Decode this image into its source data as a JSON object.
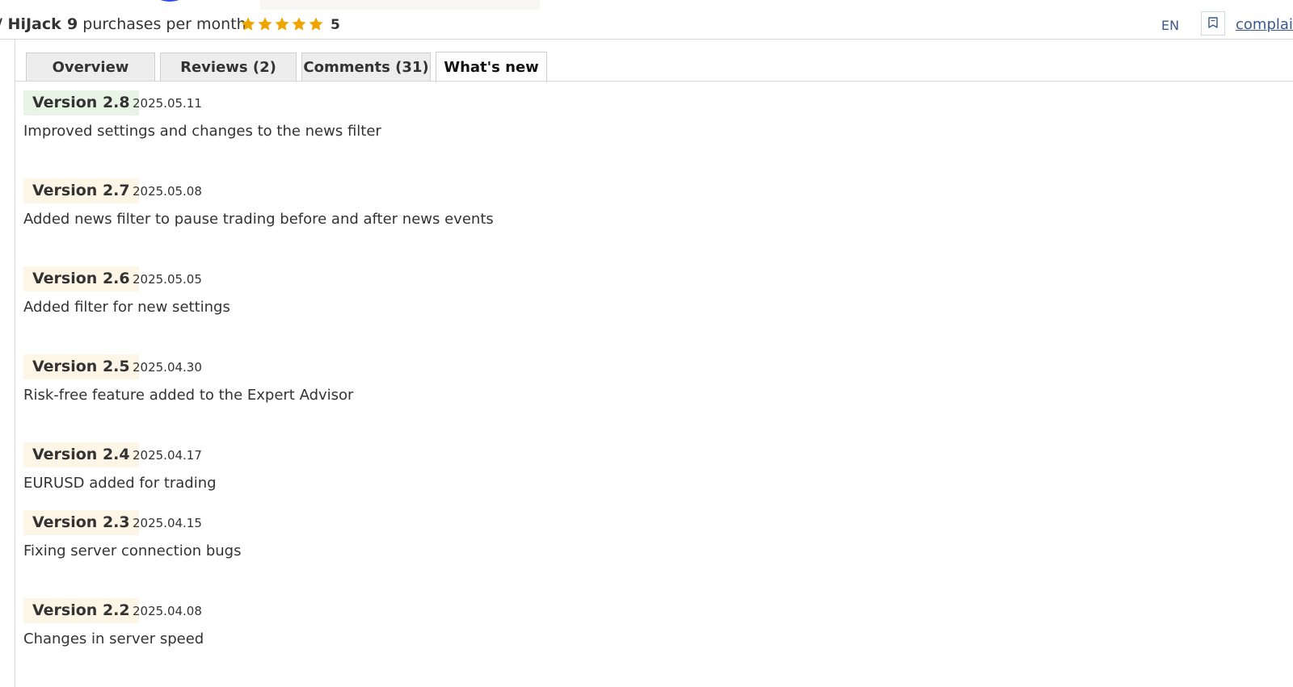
{
  "header": {
    "product_name": "/ HiJack",
    "purchases_count": "9",
    "purchases_label": "purchases per month",
    "rating": 5,
    "rating_label": "5",
    "language": "EN",
    "complain_label": "complain"
  },
  "tabs": [
    {
      "label": "Overview",
      "active": false
    },
    {
      "label": "Reviews (2)",
      "active": false
    },
    {
      "label": "Comments (31)",
      "active": false
    },
    {
      "label": "What's new",
      "active": true
    }
  ],
  "versions": [
    {
      "version": "Version 2.8",
      "date": "2025.05.11",
      "text": "Improved settings and changes to the news filter"
    },
    {
      "version": "Version 2.7",
      "date": "2025.05.08",
      "text": "Added news filter to pause trading before and after news events"
    },
    {
      "version": "Version 2.6",
      "date": "2025.05.05",
      "text": "Added filter for new settings"
    },
    {
      "version": "Version 2.5",
      "date": "2025.04.30",
      "text": "Risk-free feature added to the Expert Advisor"
    },
    {
      "version": "Version 2.4",
      "date": "2025.04.17",
      "text": "EURUSD added for trading"
    },
    {
      "version": "Version 2.3",
      "date": "2025.04.15",
      "text": "Fixing server connection bugs"
    },
    {
      "version": "Version 2.2",
      "date": "2025.04.08",
      "text": "Changes in server speed"
    }
  ],
  "colors": {
    "star": "#f0a400",
    "link": "#3a5a8c",
    "latest_badge": "#e8f5e6",
    "version_badge": "#fdf6e6"
  },
  "icons": {
    "rating": "star-icon",
    "complain": "complaint-flag-icon"
  }
}
